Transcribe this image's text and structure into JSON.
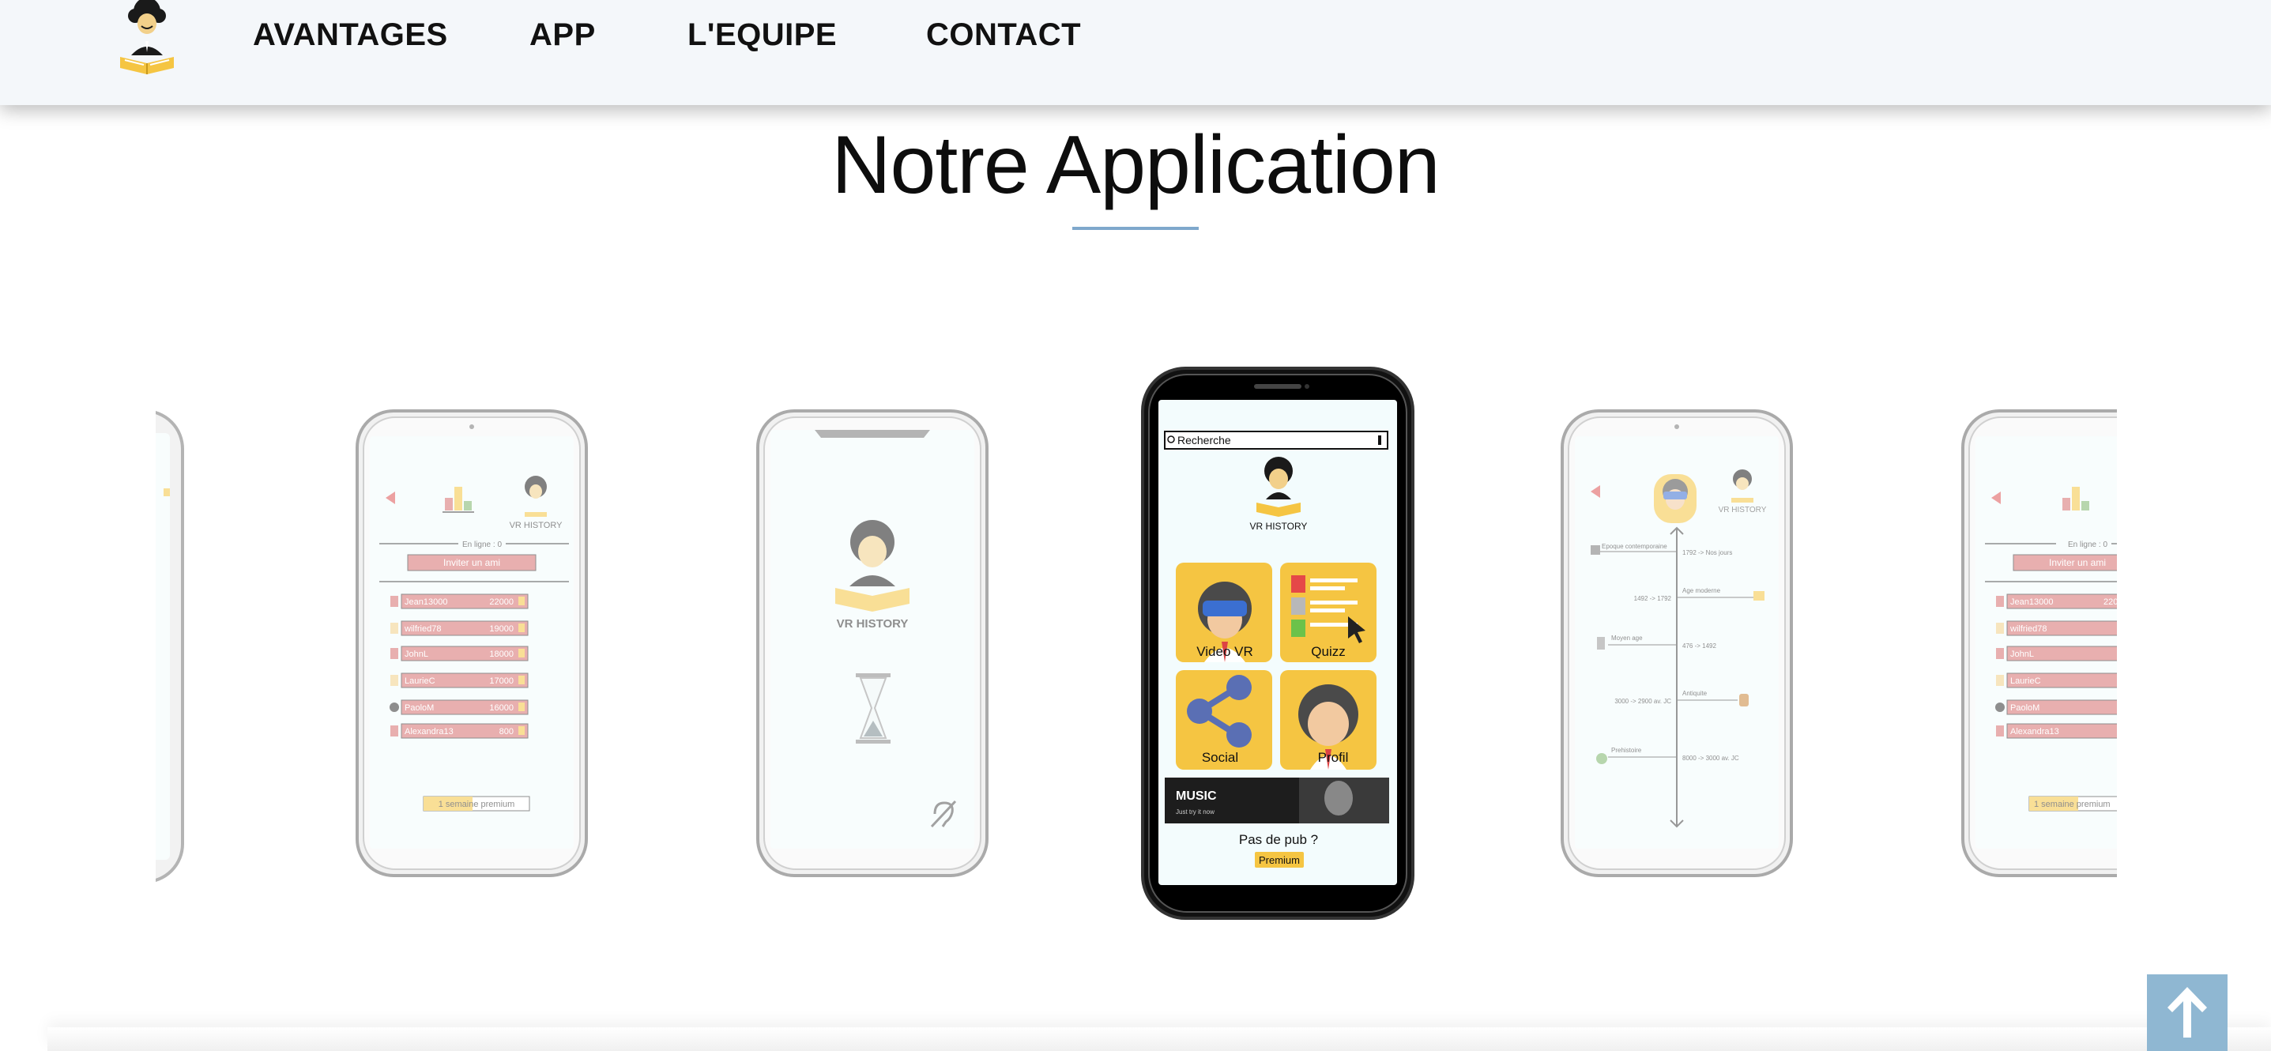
{
  "nav": {
    "links": [
      "AVANTAGES",
      "APP",
      "L'EQUIPE",
      "CONTACT"
    ]
  },
  "section": {
    "title": "Notre Application",
    "underline_color": "#7fa8cc"
  },
  "phones": {
    "leaderboard": {
      "online": "En ligne : 0",
      "invite": "Inviter un ami",
      "rows": [
        {
          "name": "Jean13000",
          "score": "22000"
        },
        {
          "name": "wilfried78",
          "score": "19000"
        },
        {
          "name": "JohnL",
          "score": "18000"
        },
        {
          "name": "LaurieC",
          "score": "17000"
        },
        {
          "name": "PaoloM",
          "score": "16000"
        },
        {
          "name": "Alexandra13",
          "score": "800"
        }
      ],
      "premium": "1 semaine premium"
    },
    "splash": {
      "brand": "VR HISTORY"
    },
    "home": {
      "search_placeholder": "Recherche",
      "brand": "VR HISTORY",
      "tiles": [
        "Video VR",
        "Quizz",
        "Social",
        "Profil"
      ],
      "ad_text": "MUSIC",
      "ad_sub": "Just try it now",
      "no_ads": "Pas de pub ?",
      "premium_button": "Premium"
    },
    "timeline": {
      "brand": "VR HISTORY",
      "events": [
        {
          "label": "Epoque contemporaine",
          "range": "1792 -> Nos jours"
        },
        {
          "label": "Age moderne",
          "range": "1492 -> 1792"
        },
        {
          "label": "Moyen age",
          "range": "476 -> 1492"
        },
        {
          "label": "Antiquite",
          "range": "3000 -> 2900 av. JC"
        },
        {
          "label": "Prehistoire",
          "range": "8000 -> 3000 av. JC"
        }
      ]
    }
  },
  "scroll_top": {
    "icon": "arrow-up-icon",
    "color": "#8fb7d2"
  },
  "colors": {
    "accent_yellow": "#f5c542",
    "leaderboard_red": "#d66f6f",
    "screen_bg": "#f3fcfd"
  }
}
